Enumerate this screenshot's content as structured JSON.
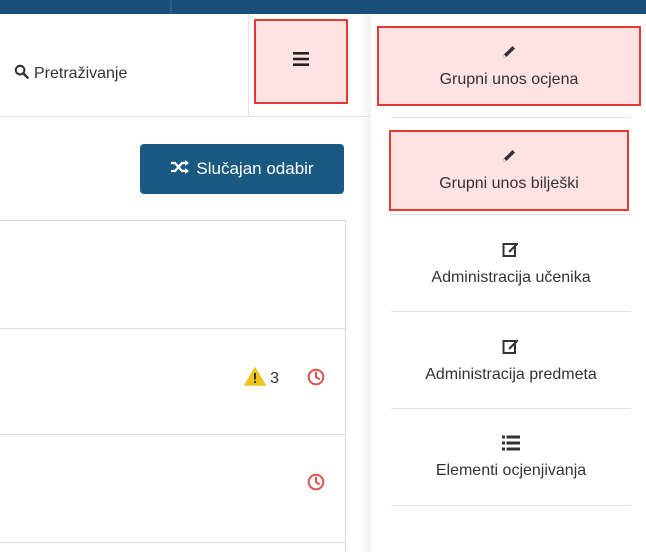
{
  "search": {
    "label": "Pretraživanje"
  },
  "toolbar": {
    "random_label": "Slučajan odabir"
  },
  "rows": [
    {
      "warning_count": "3"
    }
  ],
  "menu": {
    "items": [
      {
        "label": "Grupni unos ocjena",
        "icon": "pencil-icon"
      },
      {
        "label": "Grupni unos bilješki",
        "icon": "pencil-icon"
      },
      {
        "label": "Administracija učenika",
        "icon": "edit-icon"
      },
      {
        "label": "Administracija predmeta",
        "icon": "edit-icon"
      },
      {
        "label": "Elementi ocjenjivanja",
        "icon": "list-icon"
      }
    ]
  },
  "colors": {
    "topbar": "#1a4f7a",
    "primary_button": "#1a5a82",
    "highlight_fill": "#ffe2e2",
    "highlight_border": "#e53935",
    "clock": "#d9534f",
    "warning": "#f0c419"
  }
}
